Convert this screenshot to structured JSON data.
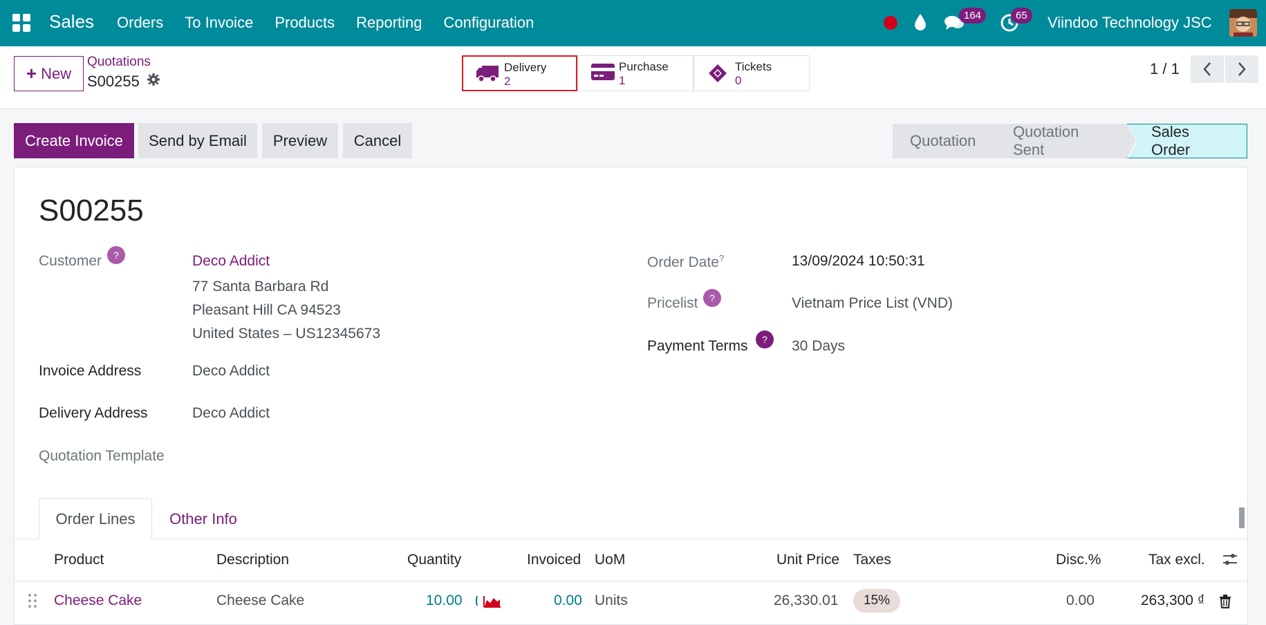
{
  "navbar": {
    "app_name": "Sales",
    "menu": [
      "Orders",
      "To Invoice",
      "Products",
      "Reporting",
      "Configuration"
    ],
    "chat_count": "164",
    "activity_count": "65",
    "company": "Viindoo Technology JSC"
  },
  "control": {
    "new_label": "New",
    "breadcrumb_parent": "Quotations",
    "breadcrumb_current": "S00255",
    "smart_buttons": [
      {
        "label": "Delivery",
        "value": "2"
      },
      {
        "label": "Purchase",
        "value": "1"
      },
      {
        "label": "Tickets",
        "value": "0"
      }
    ],
    "pager": "1 / 1"
  },
  "actions": {
    "create_invoice": "Create Invoice",
    "send_email": "Send by Email",
    "preview": "Preview",
    "cancel": "Cancel"
  },
  "statusbar": [
    "Quotation",
    "Quotation Sent",
    "Sales Order"
  ],
  "form": {
    "title": "S00255",
    "customer_label": "Customer",
    "customer_name": "Deco Addict",
    "customer_address": [
      "77 Santa Barbara Rd",
      "Pleasant Hill CA 94523",
      "United States – US12345673"
    ],
    "invoice_address_label": "Invoice Address",
    "invoice_address": "Deco Addict",
    "delivery_address_label": "Delivery Address",
    "delivery_address": "Deco Addict",
    "quotation_template_label": "Quotation Template",
    "order_date_label": "Order Date",
    "order_date": "13/09/2024 10:50:31",
    "pricelist_label": "Pricelist",
    "pricelist": "Vietnam Price List (VND)",
    "payment_terms_label": "Payment Terms",
    "payment_terms": "30 Days",
    "help_mark": "?"
  },
  "tabs": [
    "Order Lines",
    "Other Info"
  ],
  "table": {
    "headers": [
      "Product",
      "Description",
      "Quantity",
      "Invoiced",
      "UoM",
      "Unit Price",
      "Taxes",
      "Disc.%",
      "Tax excl."
    ],
    "rows": [
      {
        "product": "Cheese Cake",
        "description": "Cheese Cake",
        "quantity": "10.00",
        "invoiced": "0.00",
        "uom": "Units",
        "unit_price": "26,330.01",
        "taxes": "15%",
        "discount": "0.00",
        "tax_excl": "263,300 ₫"
      }
    ]
  },
  "colors": {
    "navbar": "#008b9a",
    "brand": "#7b1d7a",
    "highlight_border": "#e01b24"
  }
}
